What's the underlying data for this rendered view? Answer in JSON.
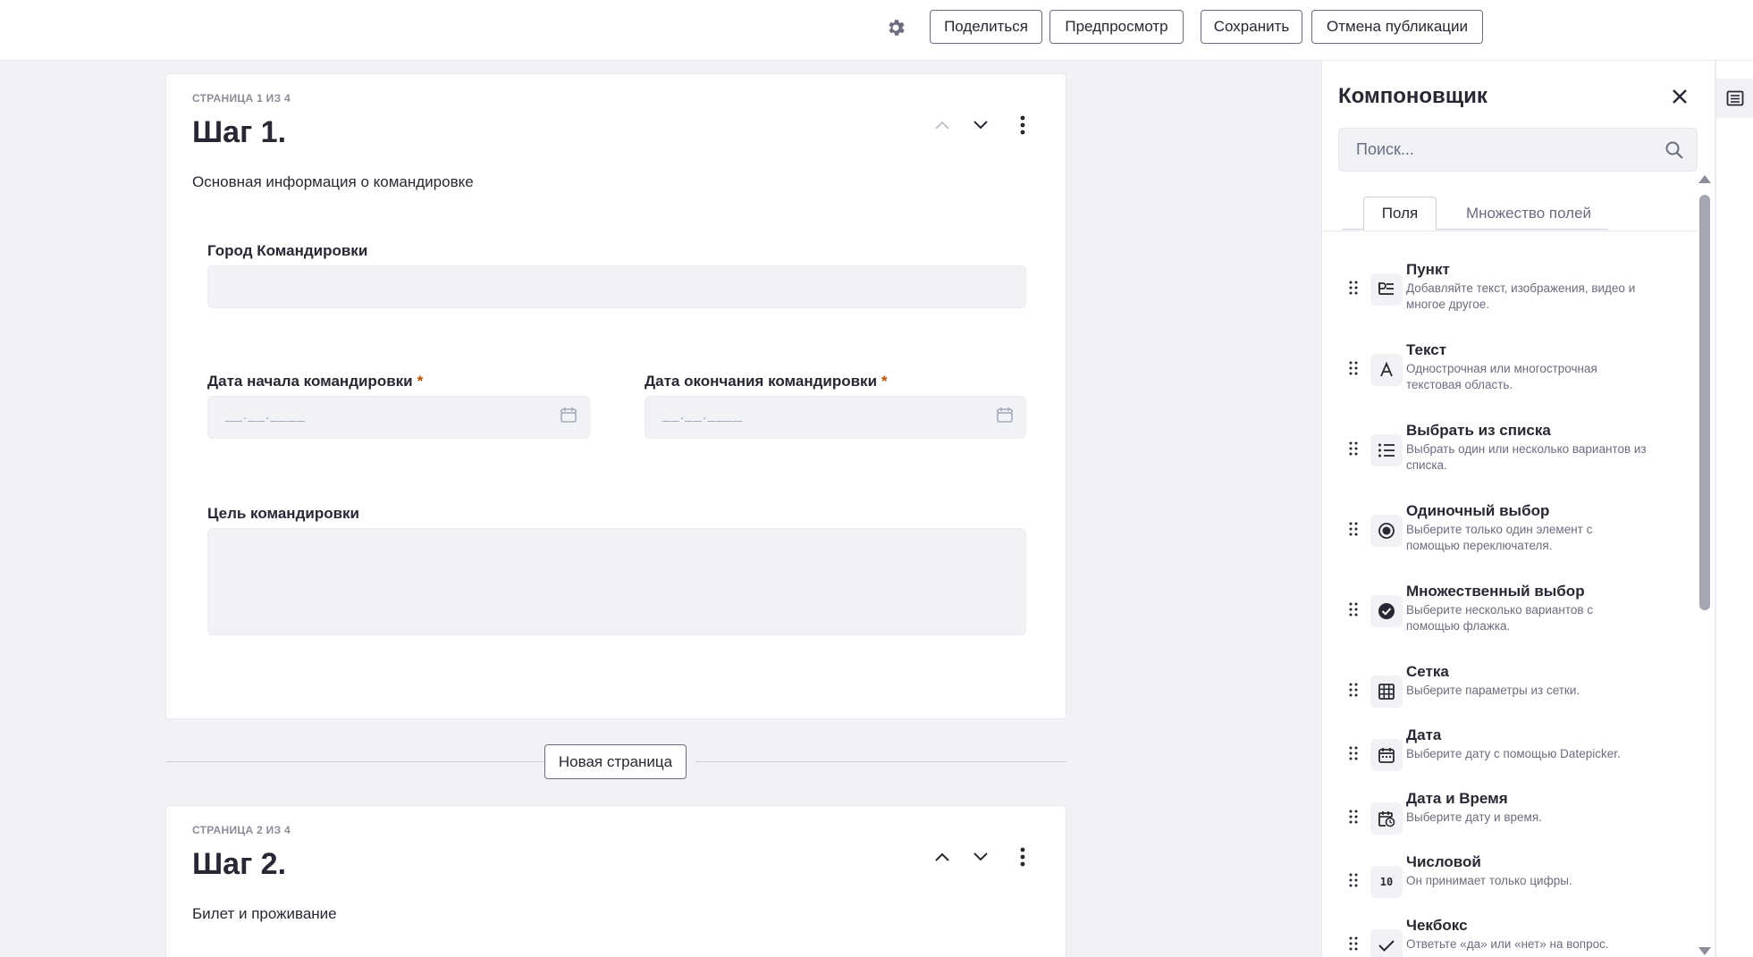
{
  "toolbar": {
    "settings_icon": "gear-icon",
    "share_label": "Поделиться",
    "preview_label": "Предпросмотр",
    "save_label": "Сохранить",
    "unpublish_label": "Отмена публикации"
  },
  "pages": [
    {
      "counter": "СТРАНИЦА 1 ИЗ 4",
      "title": "Шаг 1.",
      "description": "Основная информация о командировке",
      "fields": {
        "city_label": "Город Командировки",
        "start_label": "Дата начала командировки",
        "end_label": "Дата окончания командировки",
        "required_mark": "*",
        "date_placeholder": "__.__.____",
        "purpose_label": "Цель командировки"
      }
    },
    {
      "counter": "СТРАНИЦА 2 ИЗ 4",
      "title": "Шаг 2.",
      "description": "Билет и проживание"
    }
  ],
  "new_page_label": "Новая страница",
  "builder": {
    "title": "Компоновщик",
    "search_placeholder": "Поиск...",
    "tabs": [
      "Поля",
      "Множество полей"
    ],
    "fields": [
      {
        "title": "Пункт",
        "desc": "Добавляйте текст, изображения, видео и многое другое.",
        "icon": "paragraph-icon"
      },
      {
        "title": "Текст",
        "desc": "Однострочная или многострочная текстовая область.",
        "icon": "text-icon"
      },
      {
        "title": "Выбрать из списка",
        "desc": "Выбрать один или несколько вариантов из списка.",
        "icon": "list-icon"
      },
      {
        "title": "Одиночный выбор",
        "desc": "Выберите только один элемент с помощью переключателя.",
        "icon": "radio-icon"
      },
      {
        "title": "Множественный выбор",
        "desc": "Выберите несколько вариантов с помощью флажка.",
        "icon": "check-circle-icon"
      },
      {
        "title": "Сетка",
        "desc": "Выберите параметры из сетки.",
        "icon": "grid-icon"
      },
      {
        "title": "Дата",
        "desc": "Выберите дату с помощью Datepicker.",
        "icon": "calendar-icon"
      },
      {
        "title": "Дата и Время",
        "desc": "Выберите дату и время.",
        "icon": "date-time-icon"
      },
      {
        "title": "Числовой",
        "desc": "Он принимает только цифры.",
        "icon": "numeric-icon",
        "icon_text": "10"
      },
      {
        "title": "Чекбокс",
        "desc": "Ответьте «да» или «нет» на вопрос.",
        "icon": "check-icon"
      }
    ]
  },
  "colors": {
    "accent": "#272833",
    "required": "#b95000",
    "input_bg": "#f1f2f5",
    "muted": "#6b6c7e"
  }
}
